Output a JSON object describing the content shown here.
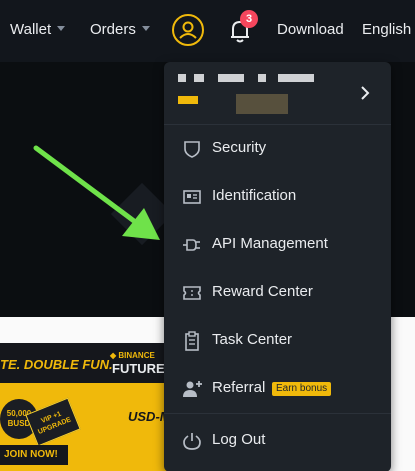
{
  "nav": {
    "wallet_label": "Wallet",
    "orders_label": "Orders",
    "notification_count": "3",
    "download_label": "Download",
    "language_label": "English"
  },
  "account_menu": {
    "items": [
      {
        "label": "Security",
        "icon": "shield-icon"
      },
      {
        "label": "Identification",
        "icon": "id-card-icon"
      },
      {
        "label": "API Management",
        "icon": "api-plug-icon"
      },
      {
        "label": "Reward Center",
        "icon": "ticket-icon"
      },
      {
        "label": "Task Center",
        "icon": "clipboard-icon"
      },
      {
        "label": "Referral",
        "icon": "add-user-icon",
        "badge": "Earn bonus"
      }
    ],
    "logout_label": "Log Out"
  },
  "banner": {
    "slogan": "TE. DOUBLE FUN.",
    "brand": "BINANCE",
    "product": "FUTURE",
    "coin_text": "50,000 BUSD",
    "ticket_text": "VIP +1 UPGRADE",
    "delivery_text": "USD-M DELIVERY",
    "join_label": "JOIN NOW!"
  },
  "colors": {
    "accent": "#f0b90b",
    "nav_bg": "#12161c",
    "menu_bg": "#1e2329",
    "badge_red": "#f6465d",
    "arrow_green": "#6fe24a"
  }
}
